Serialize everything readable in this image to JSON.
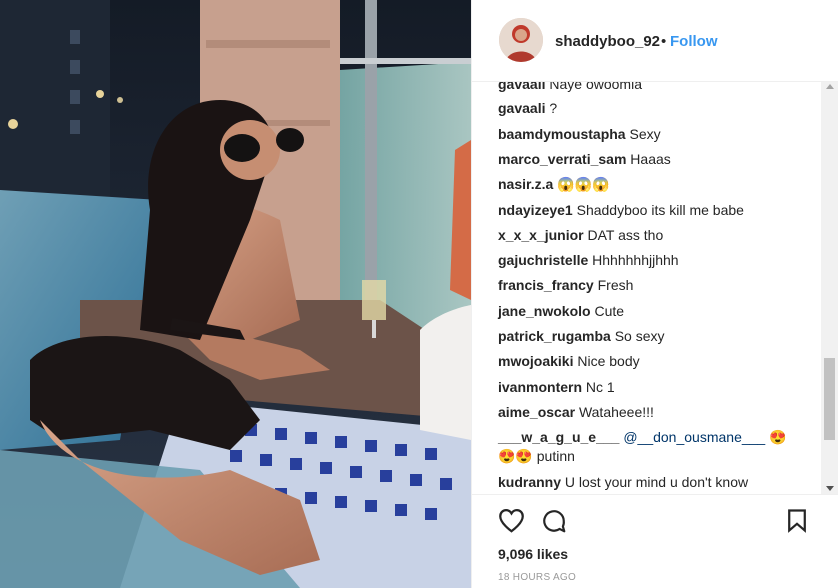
{
  "post": {
    "username": "shaddyboo_92",
    "separator": "•",
    "follow_label": "Follow",
    "likes_text": "9,096 likes",
    "time_text": "18 HOURS AGO"
  },
  "comments": [
    {
      "user": "gavaali",
      "text": " Naye owoomia"
    },
    {
      "user": "gavaali",
      "text": " ?"
    },
    {
      "user": "baamdymoustapha",
      "text": " Sexy"
    },
    {
      "user": "marco_verrati_sam",
      "text": " Haaas"
    },
    {
      "user": "nasir.z.a",
      "text": " 😱😱😱"
    },
    {
      "user": "ndayizeye1",
      "text": " Shaddyboo its kill me babe"
    },
    {
      "user": "x_x_x_junior",
      "text": " DAT ass tho"
    },
    {
      "user": "gajuchristelle",
      "text": " Hhhhhhhjjhhh"
    },
    {
      "user": "francis_francy",
      "text": " Fresh"
    },
    {
      "user": "jane_nwokolo",
      "text": " Cute"
    },
    {
      "user": "patrick_rugamba",
      "text": " So sexy"
    },
    {
      "user": "mwojoakiki",
      "text": " Nice body"
    },
    {
      "user": "ivanmontern",
      "text": " Nc 1"
    },
    {
      "user": "aime_oscar",
      "text": " Wataheee!!!"
    },
    {
      "user": "___w_a_g_u_e___",
      "mention": " @__don_ousmane___",
      "text": " 😍",
      "line2": "😍😍 putinn"
    },
    {
      "user": "kudranny",
      "text": " U lost your mind u don't know"
    }
  ],
  "icons": {
    "like": "heart-icon",
    "comment": "comment-icon",
    "save": "bookmark-icon"
  },
  "colors": {
    "link": "#3897f0",
    "text": "#262626",
    "muted": "#999999"
  }
}
